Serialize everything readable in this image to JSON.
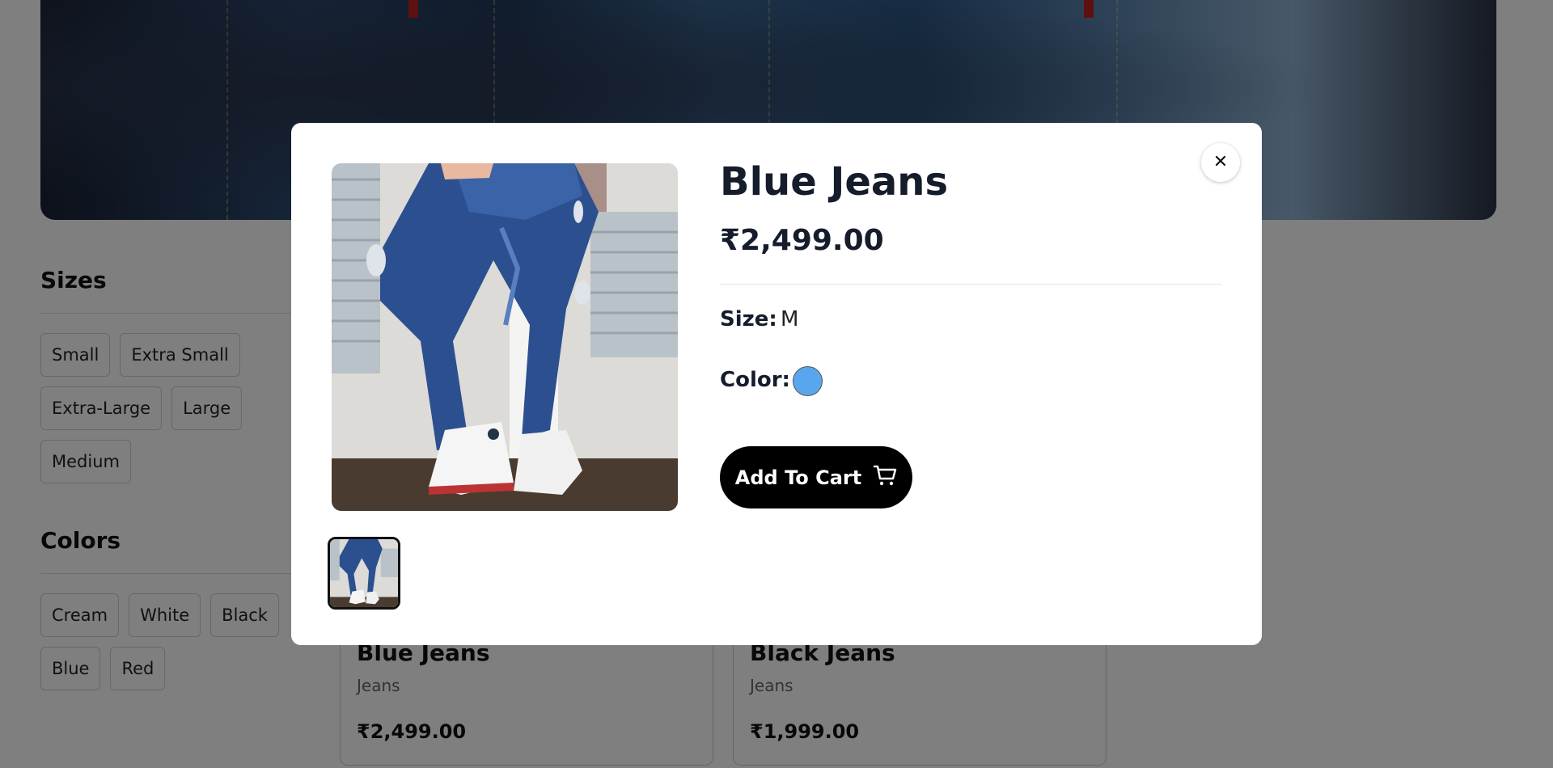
{
  "background": {
    "sizes": {
      "title": "Sizes",
      "items": [
        "Small",
        "Extra Small",
        "Extra-Large",
        "Large",
        "Medium"
      ]
    },
    "colors": {
      "title": "Colors",
      "items": [
        "Cream",
        "White",
        "Black",
        "Blue",
        "Red"
      ]
    },
    "products": [
      {
        "name": "Blue Jeans",
        "category": "Jeans",
        "price": "₹2,499.00"
      },
      {
        "name": "Black Jeans",
        "category": "Jeans",
        "price": "₹1,999.00"
      }
    ]
  },
  "modal": {
    "title": "Blue Jeans",
    "price": "₹2,499.00",
    "size_label": "Size:",
    "size_value": "M",
    "color_label": "Color:",
    "color_swatch": "#5aa6ee",
    "add_to_cart_label": "Add To Cart",
    "close_icon": "close-icon",
    "cart_icon": "cart-icon"
  }
}
